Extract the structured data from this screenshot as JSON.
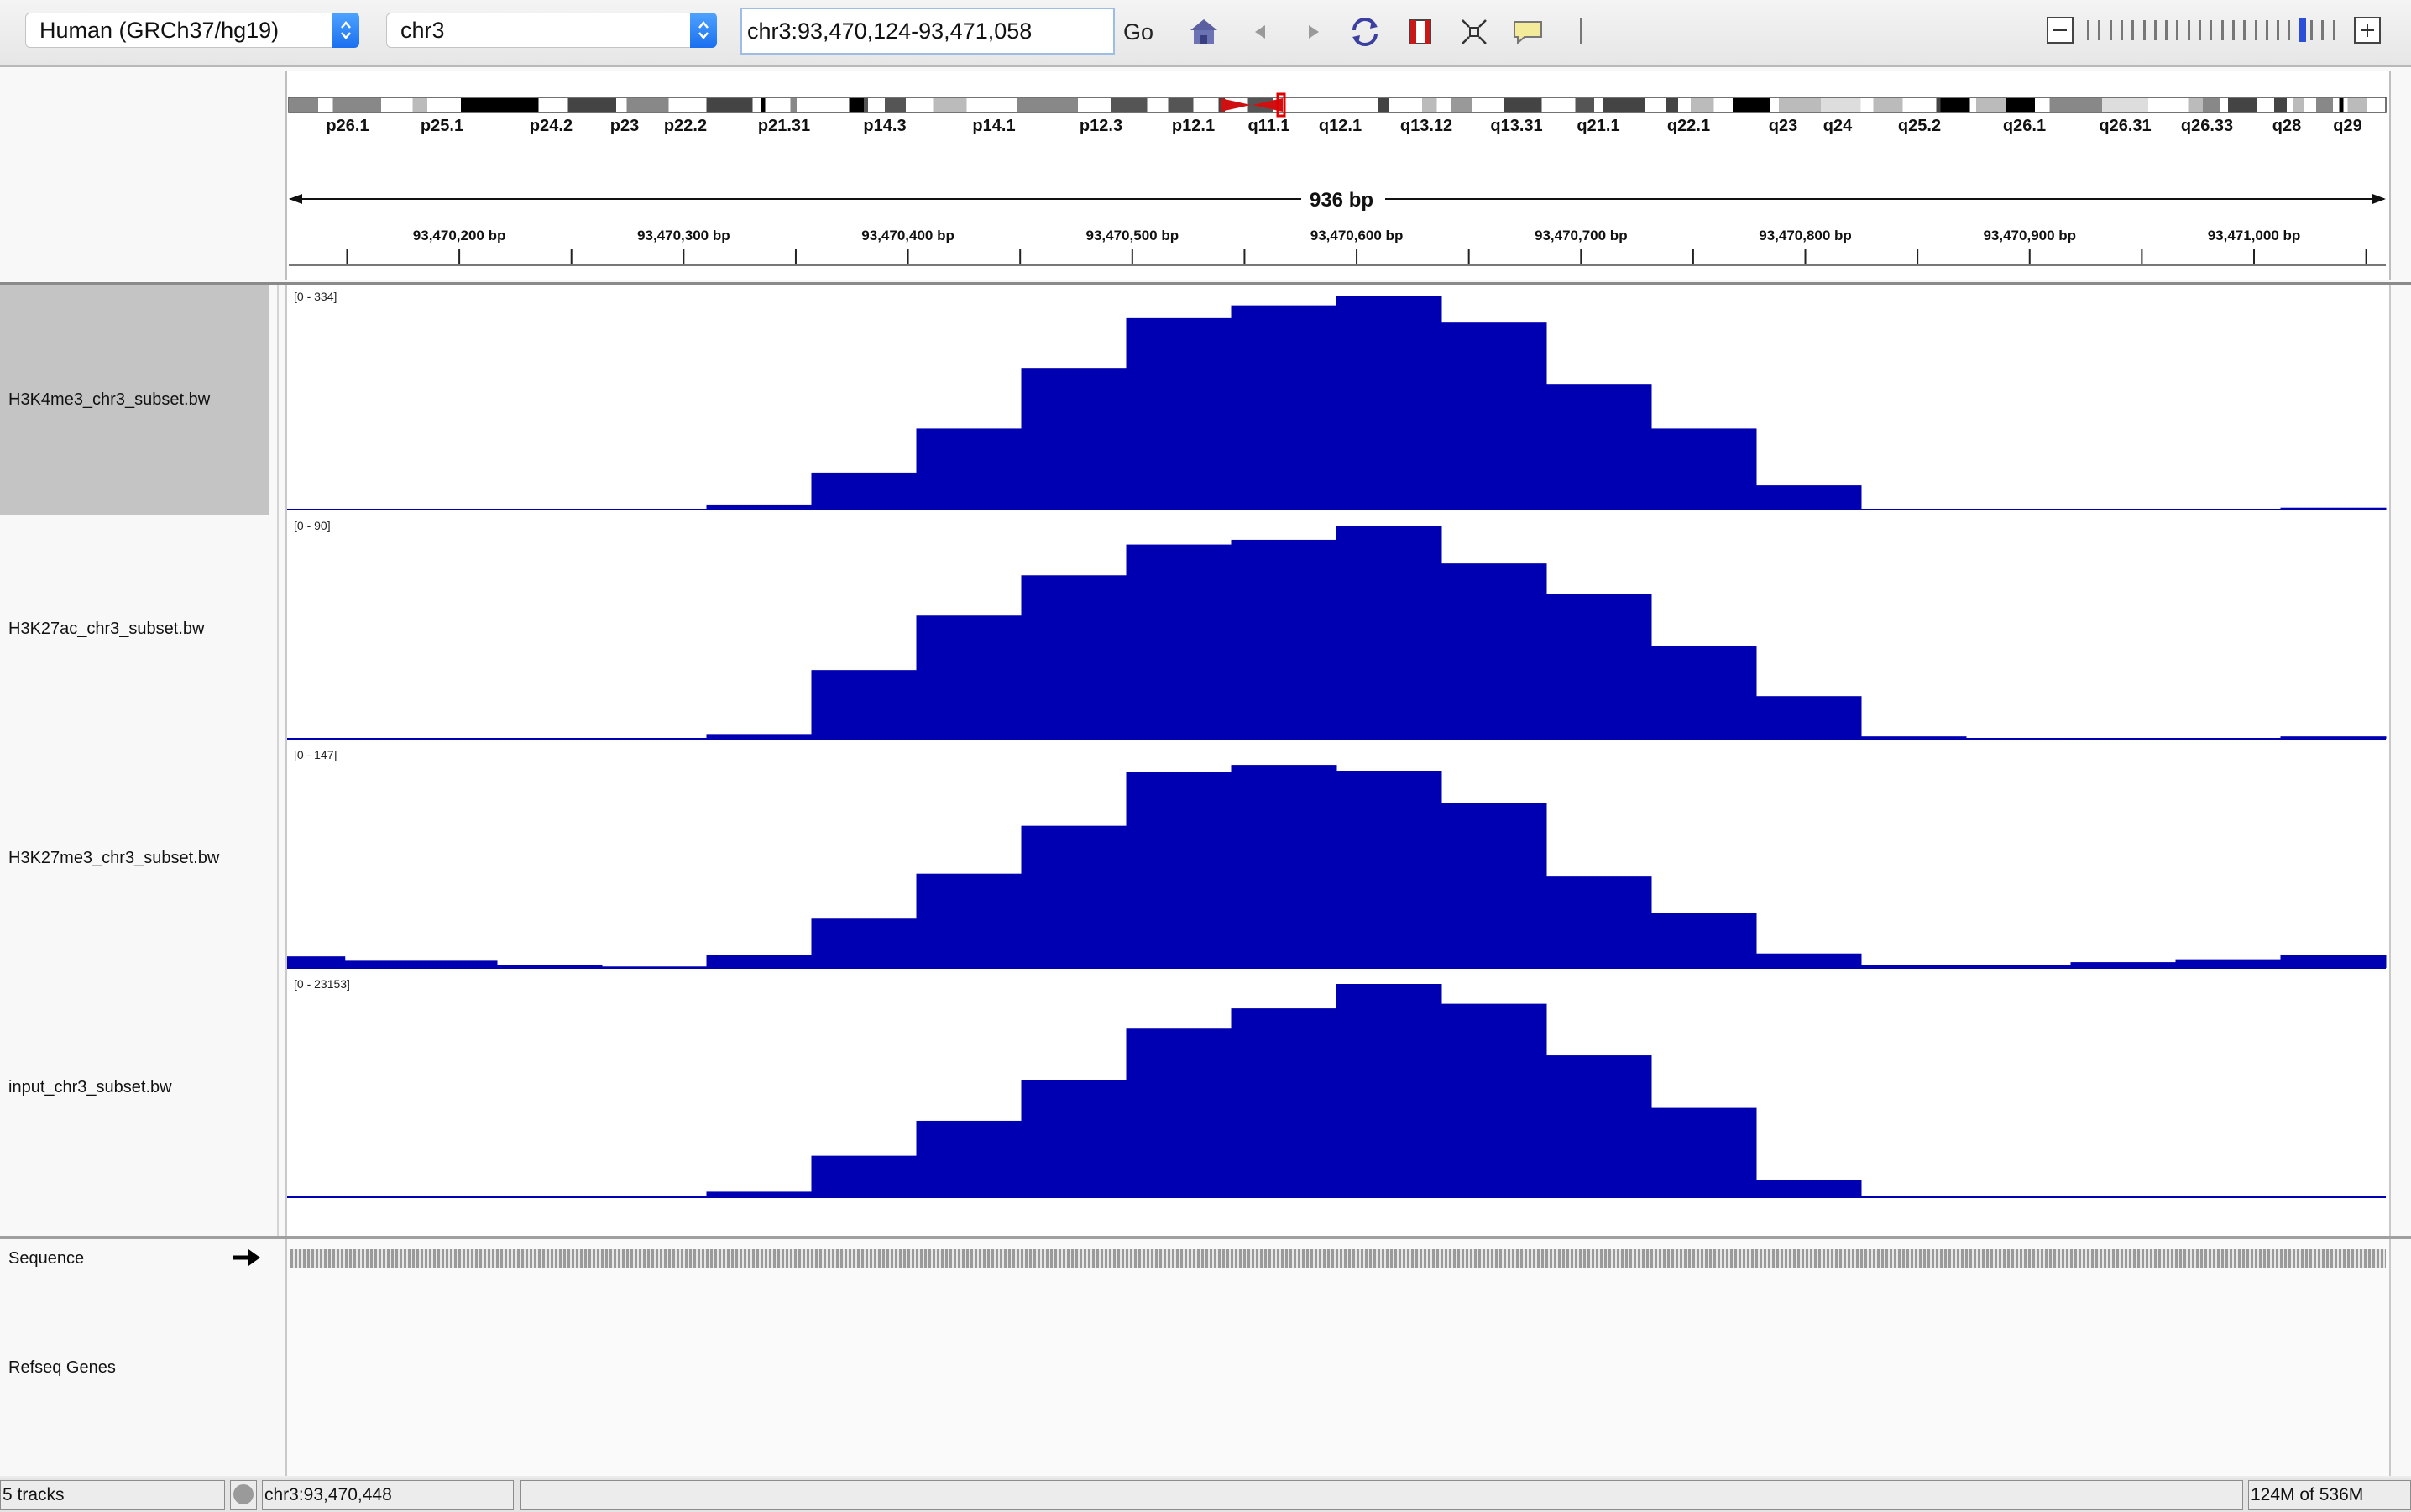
{
  "toolbar": {
    "genome": "Human (GRCh37/hg19)",
    "chromosome": "chr3",
    "locus": "chr3:93,470,124-93,471,058",
    "go_label": "Go",
    "icons": [
      "home-icon",
      "back-icon",
      "forward-icon",
      "refresh-icon",
      "roi-icon",
      "resize-icon",
      "popup-info-icon"
    ]
  },
  "ideogram": {
    "bands": [
      "p26.1",
      "p25.1",
      "p24.2",
      "p23",
      "p22.2",
      "p21.31",
      "p14.3",
      "p14.1",
      "p12.3",
      "p12.1",
      "q11.1",
      "q12.1",
      "q13.12",
      "q13.31",
      "q21.1",
      "q22.1",
      "q23",
      "q24",
      "q25.2",
      "q26.1",
      "q26.31",
      "q26.33",
      "q28",
      "q29"
    ],
    "centromere_color": "#d01010"
  },
  "ruler": {
    "span_label": "936 bp",
    "start": 93470124,
    "end": 93471058,
    "tick_labels": [
      "93,470,200 bp",
      "93,470,300 bp",
      "93,470,400 bp",
      "93,470,500 bp",
      "93,470,600 bp",
      "93,470,700 bp",
      "93,470,800 bp",
      "93,470,900 bp",
      "93,471,000 bp"
    ],
    "tick_positions": [
      93470200,
      93470300,
      93470400,
      93470500,
      93470600,
      93470700,
      93470800,
      93470900,
      93471000
    ]
  },
  "tracks": [
    {
      "name": "H3K4me3_chr3_subset.bw",
      "range": "[0 - 334]",
      "max": 334,
      "selected": true,
      "values": [
        0.5,
        0.5,
        0.5,
        0.5,
        8,
        58,
        127,
        222,
        300,
        320,
        334,
        293,
        197,
        127,
        38,
        0,
        0,
        0,
        0,
        3
      ]
    },
    {
      "name": "H3K27ac_chr3_subset.bw",
      "range": "[0 - 90]",
      "max": 90,
      "selected": false,
      "values": [
        0,
        0,
        0,
        0,
        2,
        29,
        52,
        69,
        82,
        84,
        90,
        74,
        61,
        39,
        18,
        1,
        0,
        0.2,
        0.2,
        1
      ]
    },
    {
      "name": "H3K27me3_chr3_subset.bw",
      "range": "[0 - 147]",
      "max": 147,
      "selected": false,
      "values": [
        8,
        5,
        2,
        1,
        9,
        34,
        65,
        98,
        135,
        140,
        136,
        114,
        63,
        38,
        10,
        2,
        2,
        4,
        6,
        9
      ]
    },
    {
      "name": "input_chr3_subset.bw",
      "range": "[0 - 23153]",
      "max": 23153,
      "selected": false,
      "values": [
        0,
        0,
        0,
        0,
        600,
        4500,
        8300,
        12700,
        18300,
        20500,
        23153,
        21000,
        15400,
        9700,
        1900,
        0,
        0,
        0,
        0,
        0
      ]
    }
  ],
  "bar_color": "#0000b3",
  "features": {
    "sequence_label": "Sequence",
    "genes_label": "Refseq Genes"
  },
  "status": {
    "tracks_count": "5 tracks",
    "position": "chr3:93,470,448",
    "message": "",
    "memory": "124M of 536M"
  }
}
